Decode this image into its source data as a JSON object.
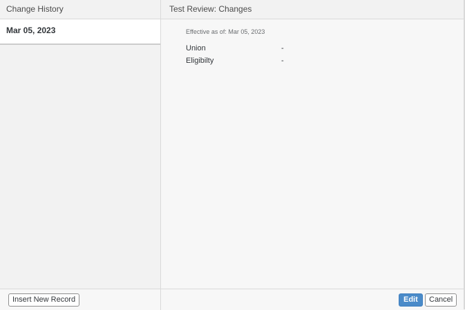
{
  "left_pane": {
    "title": "Change History",
    "items": [
      {
        "label": "Mar 05, 2023"
      }
    ]
  },
  "right_pane": {
    "title": "Test Review: Changes",
    "effective_text": "Effective as of: Mar 05, 2023",
    "fields": [
      {
        "label": "Union",
        "value": "-"
      },
      {
        "label": "Eligibilty",
        "value": "-"
      }
    ]
  },
  "footer": {
    "insert_label": "Insert New Record",
    "edit_label": "Edit",
    "cancel_label": "Cancel"
  },
  "colors": {
    "accent": "#4b8bc9",
    "background": "#f7f7f7",
    "border": "#d9d9d9"
  }
}
